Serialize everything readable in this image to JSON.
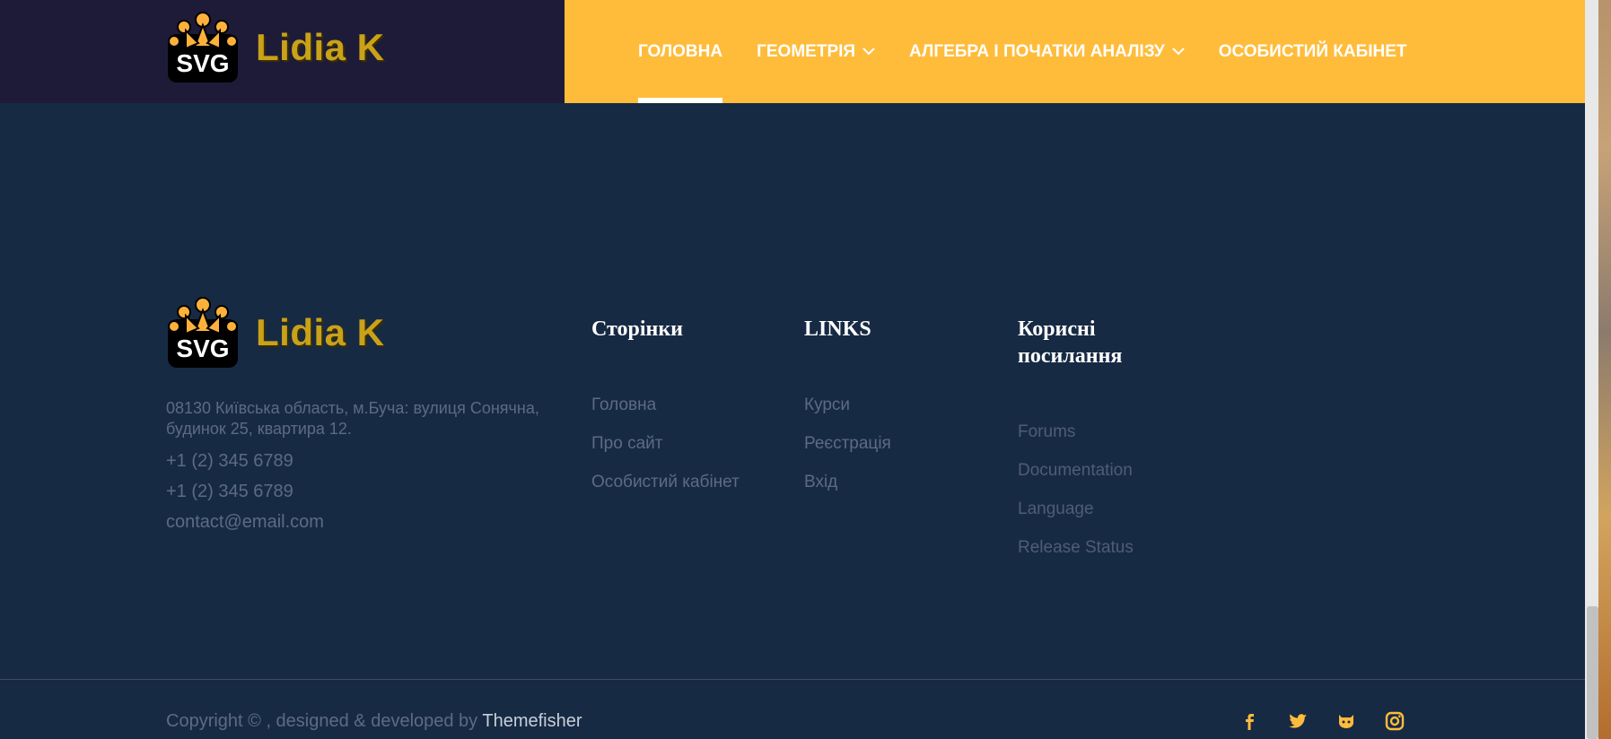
{
  "header": {
    "logo": {
      "mark_text": "SVG",
      "brand": "Lidia K"
    },
    "nav": [
      {
        "label": "ГОЛОВНА",
        "active": true,
        "dropdown": false
      },
      {
        "label": "ГЕОМЕТРІЯ",
        "active": false,
        "dropdown": true
      },
      {
        "label": "АЛГЕБРА І ПОЧАТКИ АНАЛІЗУ",
        "active": false,
        "dropdown": true
      },
      {
        "label": "ОСОБИСТИЙ КАБІНЕТ",
        "active": false,
        "dropdown": false
      }
    ]
  },
  "footer": {
    "logo": {
      "mark_text": "SVG",
      "brand": "Lidia K"
    },
    "about": {
      "address": "08130 Київська область, м.Буча: вулиця Сонячна, будинок 25, квартира 12.",
      "phone1": "+1 (2) 345 6789",
      "phone2": "+1 (2) 345 6789",
      "email": "contact@email.com"
    },
    "columns": [
      {
        "title": "Сторінки",
        "links": [
          "Головна",
          "Про сайт",
          "Особистий кабінет"
        ]
      },
      {
        "title": "LINKS",
        "links": [
          "Курси",
          "Реєстрація",
          "Вхід"
        ]
      },
      {
        "title": "Корисні посилання",
        "links": [
          "Forums",
          "Documentation",
          "Language",
          "Release Status"
        ]
      }
    ],
    "copyright": {
      "text": "Copyright © , designed & developed by ",
      "brand": "Themefisher"
    },
    "social": [
      "facebook-icon",
      "twitter-icon",
      "github-icon",
      "instagram-icon"
    ]
  },
  "colors": {
    "accent": "#ffbc3b",
    "header_dark": "#1e1b39",
    "footer_bg": "#172a44",
    "muted_text": "#5d6b82"
  }
}
